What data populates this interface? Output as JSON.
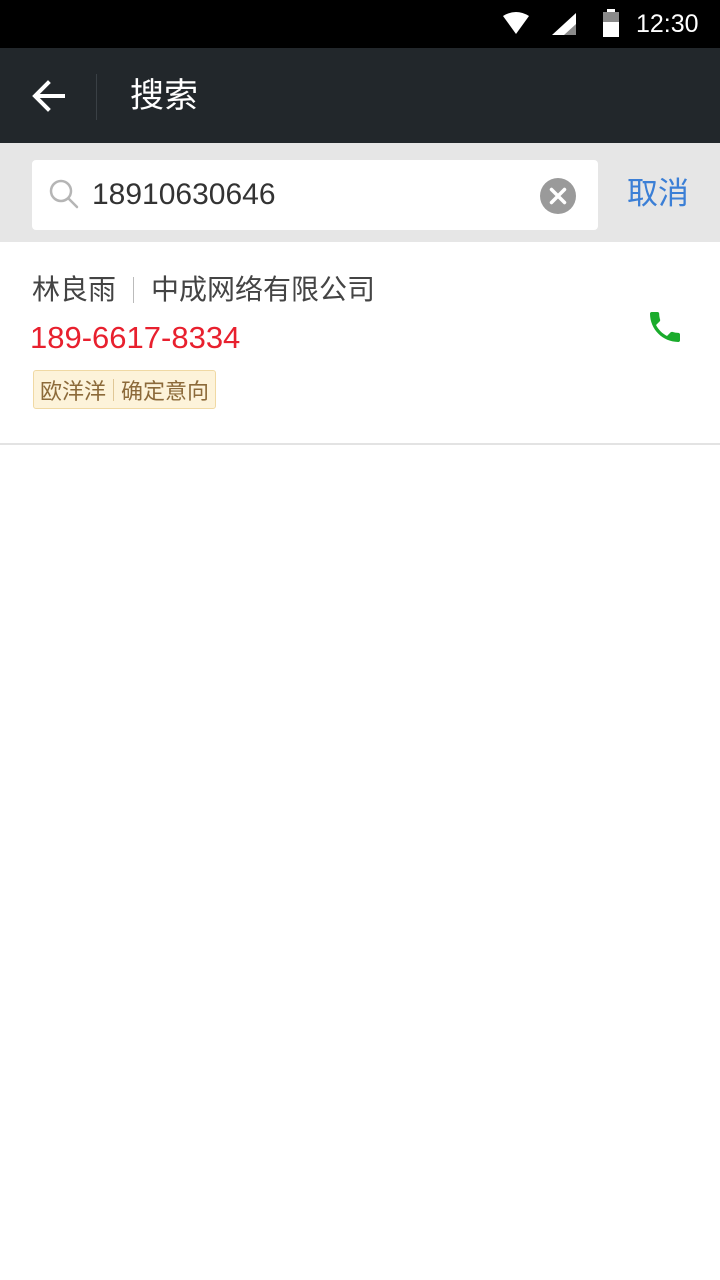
{
  "status_bar": {
    "time": "12:30",
    "icons": [
      "wifi-icon",
      "signal-icon",
      "battery-icon"
    ]
  },
  "app_bar": {
    "title": "搜索",
    "back_icon": "arrow-left-icon"
  },
  "search": {
    "value": "18910630646",
    "placeholder": "",
    "cancel_label": "取消",
    "search_icon": "search-icon",
    "clear_icon": "clear-circle-icon"
  },
  "results": [
    {
      "name": "林良雨",
      "company": "中成网络有限公司",
      "phone": "189-6617-8334",
      "tag_owner": "欧洋洋",
      "tag_status": "确定意向",
      "call_icon": "phone-icon"
    }
  ],
  "colors": {
    "app_bar_bg": "#22272b",
    "accent_blue": "#3b7fd6",
    "phone_red": "#e8202e",
    "call_green": "#1aab2c",
    "tag_bg": "#fdf3da"
  }
}
